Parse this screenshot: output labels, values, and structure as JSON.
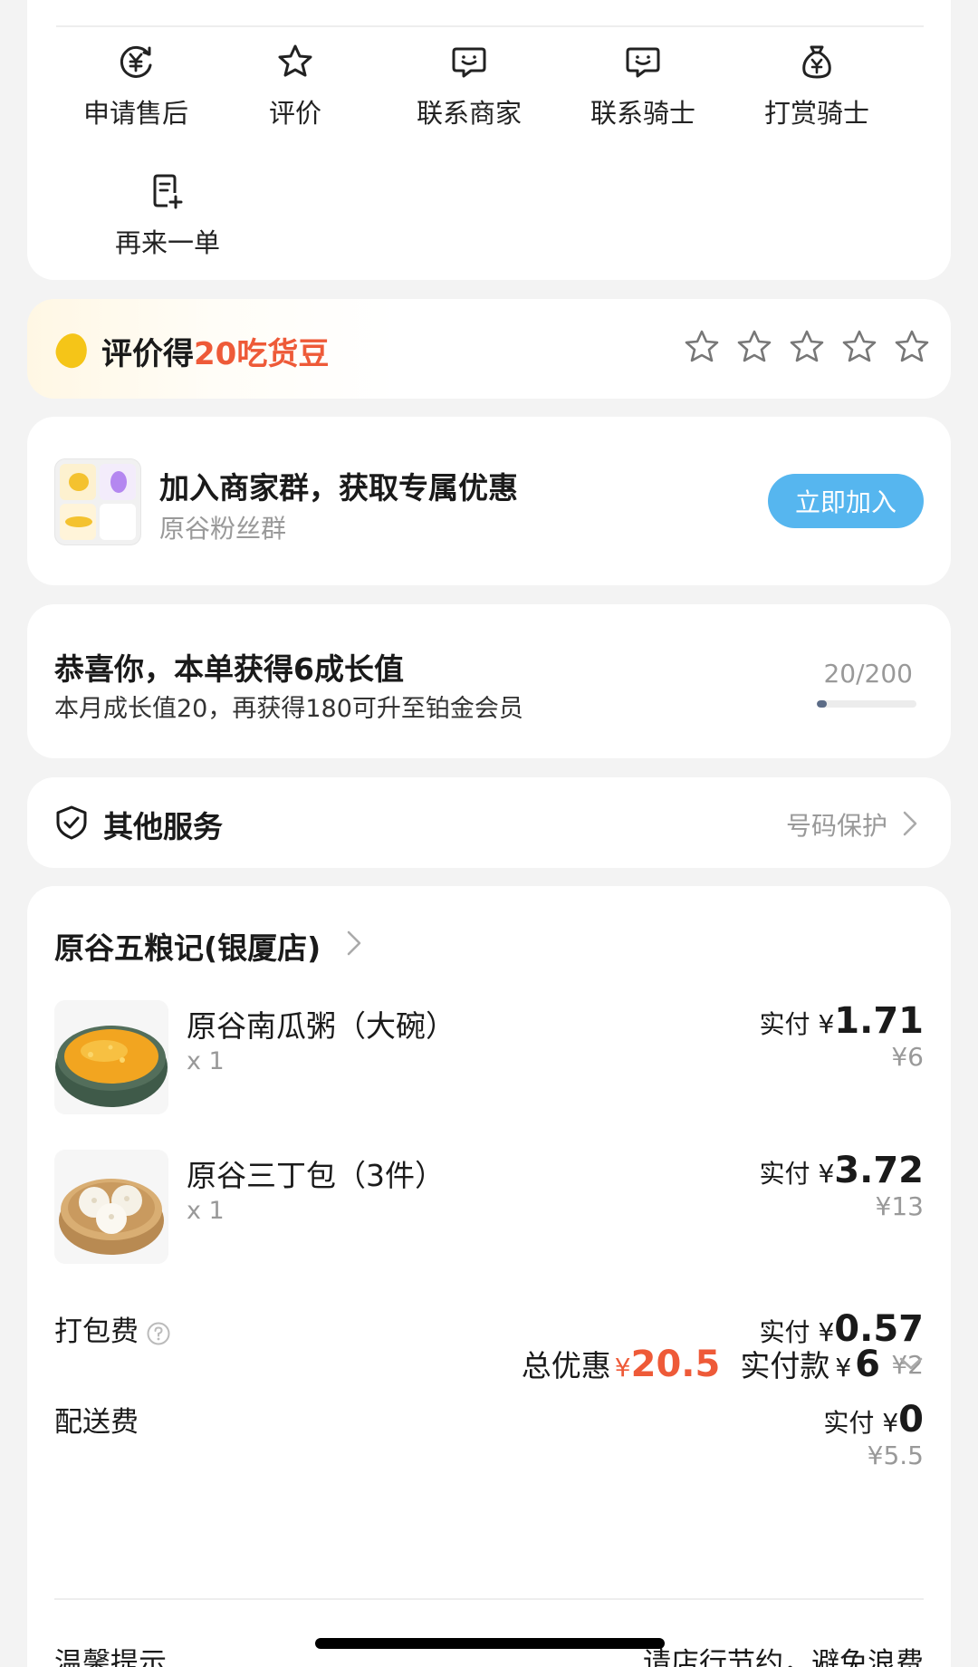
{
  "actions": [
    {
      "label": "申请售后",
      "icon": "refund-yen-icon"
    },
    {
      "label": "评价",
      "icon": "star-icon"
    },
    {
      "label": "联系商家",
      "icon": "chat-merchant-icon"
    },
    {
      "label": "联系骑士",
      "icon": "chat-rider-icon"
    },
    {
      "label": "打赏骑士",
      "icon": "money-bag-icon"
    },
    {
      "label": "再来一单",
      "icon": "reorder-icon"
    }
  ],
  "review": {
    "prefix": "评价得",
    "highlight": "20吃货豆",
    "star_count": 5
  },
  "group": {
    "title": "加入商家群，获取专属优惠",
    "subtitle": "原谷粉丝群",
    "button": "立即加入"
  },
  "growth": {
    "title": "恭喜你，本单获得6成长值",
    "subtitle": "本月成长值20，再获得180可升至铂金会员",
    "count": "20/200",
    "progress": 0.1
  },
  "service": {
    "title": "其他服务",
    "right": "号码保护"
  },
  "order": {
    "store": "原谷五粮记(银厦店)",
    "items": [
      {
        "name": "原谷南瓜粥（大碗）",
        "qty": "x 1",
        "pay_label": "实付",
        "pay_currency": "¥",
        "pay": "1.71",
        "original": "¥6"
      },
      {
        "name": "原谷三丁包（3件）",
        "qty": "x 1",
        "pay_label": "实付",
        "pay_currency": "¥",
        "pay": "3.72",
        "original": "¥13"
      }
    ],
    "fees": [
      {
        "label": "打包费",
        "pay_label": "实付",
        "pay_currency": "¥",
        "pay": "0.57",
        "original": "¥2",
        "help": true
      },
      {
        "label": "配送费",
        "pay_label": "实付",
        "pay_currency": "¥",
        "pay": "0",
        "original": "¥5.5",
        "help": false
      }
    ],
    "summary": {
      "discount_label": "总优惠",
      "discount_currency": "¥",
      "discount": "20.5",
      "total_label": "实付款",
      "total_currency": "¥",
      "total": "6"
    },
    "tip_left": "温馨提示",
    "tip_right": "请店行节约，避免浪费"
  },
  "colors": {
    "accent_red": "#ee5a38",
    "button_blue": "#56b6ef",
    "gold": "#f5c518"
  }
}
